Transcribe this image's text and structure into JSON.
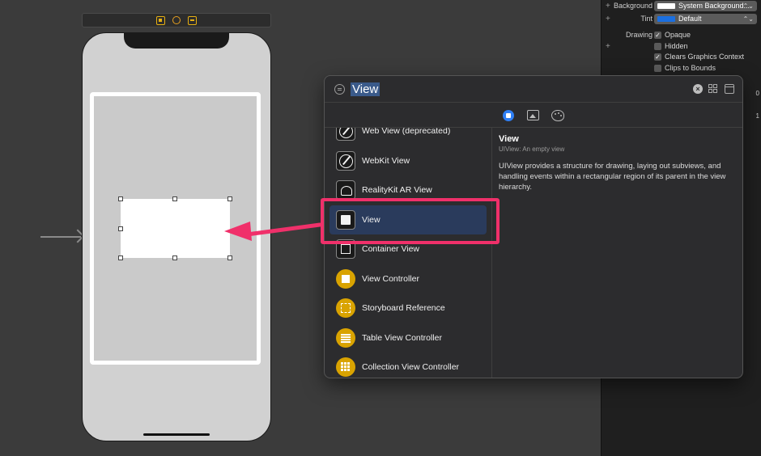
{
  "canvas": {
    "scene_bar_icons": [
      "view-controller-icon",
      "first-responder-icon",
      "exit-icon"
    ]
  },
  "inspector": {
    "background_label": "Background",
    "background_value": "System Background...",
    "background_swatch": "#ffffff",
    "tint_label": "Tint",
    "tint_value": "Default",
    "tint_swatch": "#1a6fe0",
    "drawing_label": "Drawing",
    "checks": [
      {
        "label": "Opaque",
        "checked": true
      },
      {
        "label": "Hidden",
        "checked": false
      },
      {
        "label": "Clears Graphics Context",
        "checked": true
      },
      {
        "label": "Clips to Bounds",
        "checked": false
      }
    ],
    "stepper_values": [
      "0",
      "1"
    ]
  },
  "library": {
    "search_query": "View",
    "items": [
      {
        "label": "Web View (deprecated)",
        "icon": "compass-icon"
      },
      {
        "label": "WebKit View",
        "icon": "compass-icon"
      },
      {
        "label": "RealityKit AR View",
        "icon": "ar-icon"
      },
      {
        "label": "View",
        "icon": "view-square-icon"
      },
      {
        "label": "Container View",
        "icon": "container-view-icon"
      },
      {
        "label": "View Controller",
        "icon": "view-controller-icon"
      },
      {
        "label": "Storyboard Reference",
        "icon": "storyboard-reference-icon"
      },
      {
        "label": "Table View Controller",
        "icon": "table-view-controller-icon"
      },
      {
        "label": "Collection View Controller",
        "icon": "collection-view-controller-icon"
      }
    ],
    "selected_index": 3,
    "detail": {
      "title": "View",
      "subtitle": "UIView: An empty view",
      "description": "UIView provides a structure for drawing, laying out subviews, and handling events within a rectangular region of its parent in the view hierarchy."
    }
  },
  "colors": {
    "highlight": "#f0306a",
    "accent": "#2f7ff5",
    "gold": "#d9a300"
  }
}
